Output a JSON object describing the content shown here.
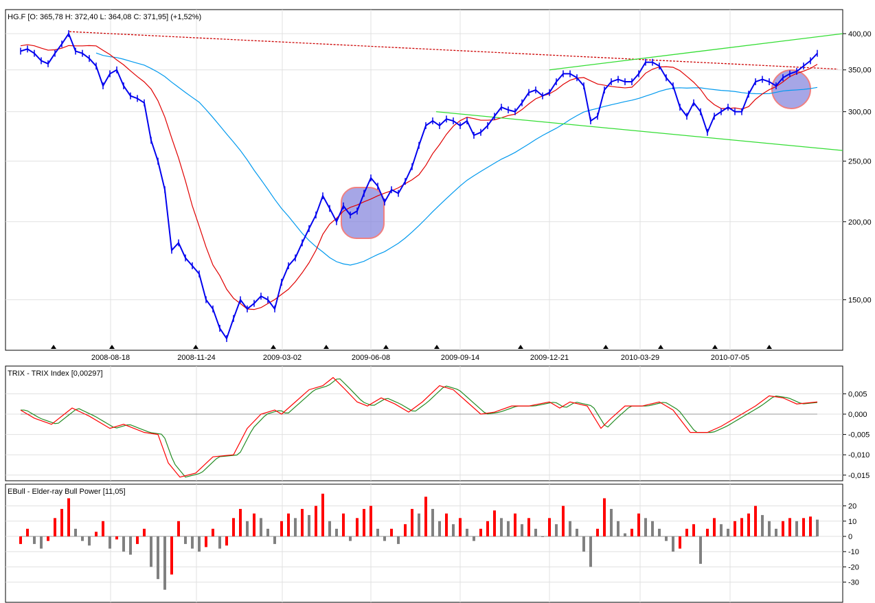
{
  "header": {
    "title": "HG.F [O: 365,78  H: 372,40  L: 364,08  C: 371,95] (+1,52%)"
  },
  "colors": {
    "price": "#0000ee",
    "ma_fast": "#e00000",
    "ma_slow": "#0099ee",
    "trend_red": "#cc0000",
    "trend_green": "#33dd33",
    "trix": "#ff0000",
    "trix_signal": "#228b22",
    "bull_up": "#ff0000",
    "bull_down": "#808080",
    "highlight": "#8888dd"
  },
  "chart_data": [
    {
      "type": "line",
      "title": "HG.F [O: 365,78  H: 372,40  L: 364,08  C: 371,95] (+1,52%)",
      "scale": "log",
      "ylim": [
        125,
        420
      ],
      "yticks": [
        {
          "v": 400,
          "label": "400,00"
        },
        {
          "v": 350,
          "label": "350,00"
        },
        {
          "v": 300,
          "label": "300,00"
        },
        {
          "v": 250,
          "label": "250,00"
        },
        {
          "v": 200,
          "label": "200,00"
        },
        {
          "v": 150,
          "label": "150,00"
        }
      ],
      "xticks": [
        {
          "i": 13.1,
          "label": "2008-08-18"
        },
        {
          "i": 25.6,
          "label": "2008-11-24"
        },
        {
          "i": 38.1,
          "label": "2009-03-02"
        },
        {
          "i": 51,
          "label": "2009-06-08"
        },
        {
          "i": 64,
          "label": "2009-09-14"
        },
        {
          "i": 77,
          "label": "2009-12-21"
        },
        {
          "i": 90.2,
          "label": "2010-03-29"
        },
        {
          "i": 103.3,
          "label": "2010-07-05"
        }
      ],
      "markers": [
        4.8,
        13.3,
        25.5,
        36.8,
        44.5,
        53.2,
        60.6,
        72.8,
        85.2,
        93.2,
        101.1,
        109
      ],
      "close": [
        375,
        378,
        372,
        362,
        358,
        372,
        385,
        400,
        375,
        372,
        365,
        355,
        330,
        345,
        350,
        330,
        318,
        315,
        310,
        270,
        250,
        225,
        180,
        185,
        175,
        170,
        165,
        150,
        145,
        135,
        130,
        140,
        150,
        145,
        148,
        152,
        150,
        145,
        160,
        170,
        175,
        185,
        195,
        205,
        220,
        210,
        200,
        212,
        205,
        208,
        222,
        235,
        228,
        215,
        225,
        222,
        232,
        245,
        265,
        285,
        290,
        285,
        292,
        290,
        285,
        290,
        275,
        278,
        285,
        295,
        305,
        302,
        300,
        310,
        322,
        325,
        318,
        322,
        335,
        345,
        345,
        340,
        330,
        290,
        295,
        325,
        335,
        338,
        335,
        335,
        345,
        360,
        360,
        355,
        340,
        330,
        305,
        295,
        310,
        300,
        278,
        295,
        300,
        305,
        300,
        300,
        320,
        335,
        338,
        335,
        330,
        340,
        345,
        348,
        355,
        362,
        372
      ],
      "ma_fast_window": 7,
      "ma_slow_window": 27,
      "trendlines": [
        {
          "name": "resistance-red",
          "from": [
            7.1,
            403
          ],
          "to": [
            119,
            351
          ],
          "style": "dashed"
        },
        {
          "name": "channel-upper-green",
          "from": [
            77,
            350
          ],
          "to": [
            119.7,
            400
          ]
        },
        {
          "name": "channel-lower-green",
          "from": [
            60.5,
            300
          ],
          "to": [
            119.7,
            260
          ]
        }
      ]
    },
    {
      "type": "line",
      "title": "TRIX - TRIX Index [0,00297]",
      "ylim": [
        -0.0155,
        0.0095
      ],
      "yticks": [
        {
          "v": 0.005,
          "label": "0,005"
        },
        {
          "v": 0,
          "label": "0,000"
        },
        {
          "v": -0.005,
          "label": "-0,005"
        },
        {
          "v": -0.01,
          "label": "-0,010"
        },
        {
          "v": -0.015,
          "label": "-0,015"
        }
      ],
      "trix": [
        [
          0,
          0.001
        ],
        [
          2,
          -0.001
        ],
        [
          4.5,
          -0.0025
        ],
        [
          7.5,
          0.0015
        ],
        [
          10,
          -0.0005
        ],
        [
          13,
          -0.0035
        ],
        [
          15,
          -0.0025
        ],
        [
          18,
          -0.0045
        ],
        [
          20,
          -0.005
        ],
        [
          21.5,
          -0.012
        ],
        [
          23.2,
          -0.0155
        ],
        [
          25.5,
          -0.0145
        ],
        [
          28,
          -0.0105
        ],
        [
          31,
          -0.01
        ],
        [
          33,
          -0.0035
        ],
        [
          35,
          0
        ],
        [
          37,
          0.001
        ],
        [
          38,
          0
        ],
        [
          40,
          0.003
        ],
        [
          42,
          0.006
        ],
        [
          44,
          0.007
        ],
        [
          45.5,
          0.009
        ],
        [
          47,
          0.0065
        ],
        [
          49,
          0.003
        ],
        [
          50.5,
          0.002
        ],
        [
          52.5,
          0.004
        ],
        [
          54.5,
          0.0025
        ],
        [
          56.5,
          0.0005
        ],
        [
          58.5,
          0.003
        ],
        [
          61,
          0.007
        ],
        [
          63,
          0.006
        ],
        [
          65,
          0.003
        ],
        [
          67,
          0
        ],
        [
          69,
          0.0005
        ],
        [
          71.5,
          0.002
        ],
        [
          74,
          0.002
        ],
        [
          77,
          0.003
        ],
        [
          78.5,
          0.0015
        ],
        [
          80,
          0.003
        ],
        [
          82.5,
          0.002
        ],
        [
          84.5,
          -0.0035
        ],
        [
          86,
          -0.001
        ],
        [
          88,
          0.002
        ],
        [
          90.5,
          0.002
        ],
        [
          93,
          0.003
        ],
        [
          95,
          0.001
        ],
        [
          97.5,
          -0.0045
        ],
        [
          100,
          -0.0045
        ],
        [
          102,
          -0.003
        ],
        [
          105,
          0
        ],
        [
          107,
          0.002
        ],
        [
          109,
          0.0045
        ],
        [
          111,
          0.004
        ],
        [
          113,
          0.0025
        ],
        [
          116,
          0.003
        ]
      ]
    },
    {
      "type": "bar",
      "title": "EBull - Elder-ray Bull Power [11,05]",
      "ylim": [
        -40,
        28
      ],
      "yticks": [
        {
          "v": 20,
          "label": "20"
        },
        {
          "v": 10,
          "label": "10"
        },
        {
          "v": 0,
          "label": "0"
        },
        {
          "v": -10,
          "label": "-10"
        },
        {
          "v": -20,
          "label": "-20"
        },
        {
          "v": -30,
          "label": "-30"
        }
      ],
      "values": [
        -5,
        5,
        -5,
        -8,
        -3,
        12,
        18,
        25,
        5,
        -3,
        -6,
        3,
        10,
        -8,
        -2,
        -10,
        -12,
        -5,
        5,
        -20,
        -28,
        -35,
        -25,
        10,
        -5,
        -8,
        -10,
        -7,
        5,
        -8,
        -6,
        12,
        18,
        10,
        15,
        12,
        5,
        -5,
        10,
        15,
        12,
        18,
        14,
        20,
        28,
        10,
        5,
        15,
        -3,
        12,
        18,
        20,
        5,
        -3,
        5,
        -5,
        8,
        18,
        15,
        26,
        18,
        10,
        15,
        8,
        12,
        5,
        -3,
        5,
        10,
        17,
        12,
        10,
        15,
        8,
        12,
        5,
        0,
        12,
        8,
        20,
        10,
        5,
        -10,
        -20,
        5,
        25,
        18,
        10,
        2,
        5,
        15,
        12,
        10,
        5,
        -3,
        -10,
        -8,
        5,
        8,
        -18,
        5,
        12,
        8,
        5,
        10,
        12,
        15,
        20,
        14,
        10,
        5,
        10,
        12,
        10,
        12,
        13,
        11
      ]
    }
  ]
}
